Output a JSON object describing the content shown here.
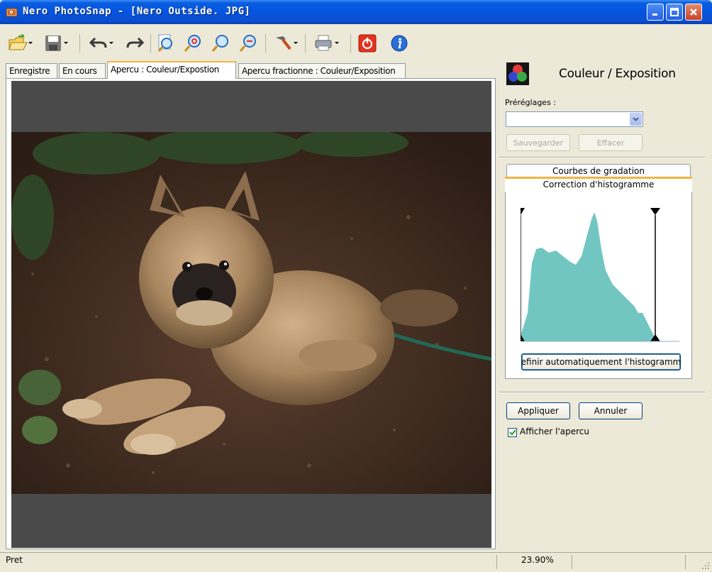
{
  "window": {
    "title": "Nero PhotoSnap  -  [Nero Outside. JPG]",
    "minimize_label": "_",
    "maximize_label": "□",
    "close_label": "✕"
  },
  "toolbar": {
    "icons": [
      "open-icon",
      "save-icon",
      "undo-icon",
      "redo-icon",
      "zoom-fit-icon",
      "zoom-in-icon",
      "zoom-icon",
      "zoom-out-icon",
      "tools-icon",
      "print-icon",
      "power-icon",
      "info-icon"
    ]
  },
  "tabs": [
    {
      "label": "Enregistre"
    },
    {
      "label": "En cours"
    },
    {
      "label": "Apercu : Couleur/Expostion"
    },
    {
      "label": "Apercu fractionne : Couleur/Exposition"
    }
  ],
  "panel": {
    "title": "Couleur / Exposition",
    "presets_label": "Préréglages :",
    "presets_value": "",
    "save_button": "Sauvegarder",
    "clear_button": "Effacer",
    "subtab_curves": "Courbes de gradation",
    "subtab_histogram": "Correction d'histogramme",
    "auto_button": "efinir automatiquement l'histogramm",
    "apply_button": "Appliquer",
    "cancel_button": "Annuler",
    "preview_checkbox_label": "Afficher l'apercu",
    "preview_checked": true
  },
  "status": {
    "text": "Pret",
    "zoom": "23.90%"
  },
  "colors": {
    "titlebar": "#0554e0",
    "histogram_fill": "#72c6c2",
    "tab_highlight": "#f7b440"
  }
}
